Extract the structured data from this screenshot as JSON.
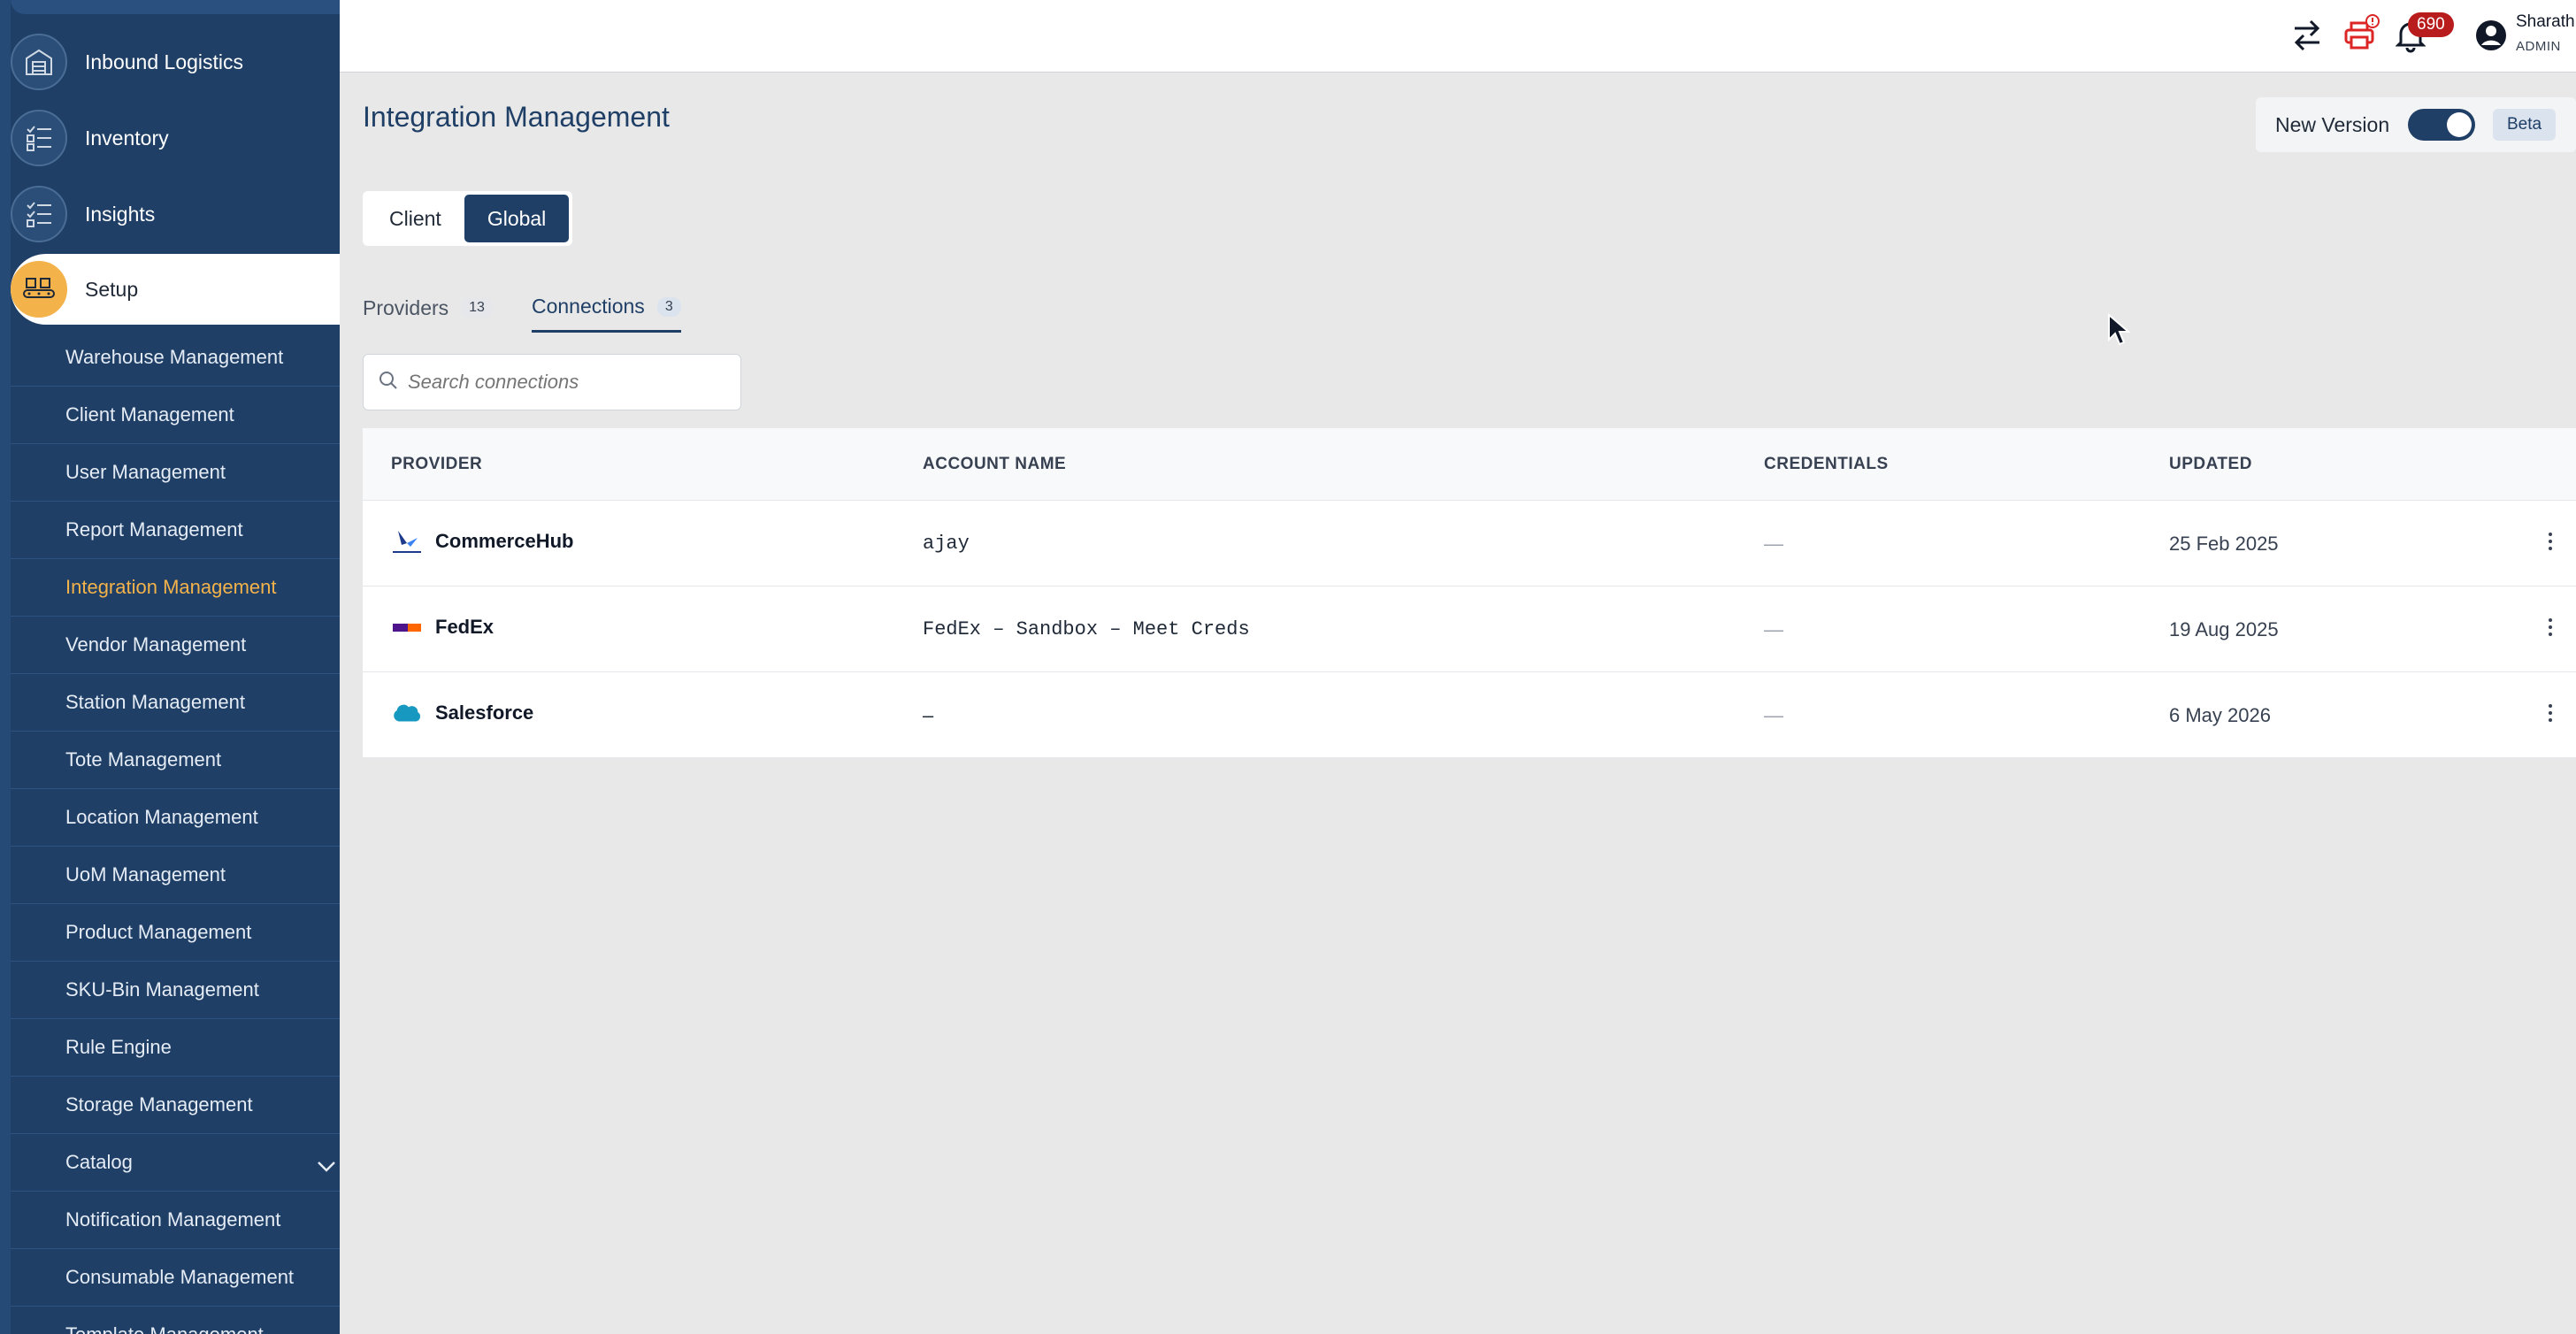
{
  "sidebar": {
    "main_items": [
      {
        "label": "Inbound Logistics",
        "icon": "warehouse-icon"
      },
      {
        "label": "Inventory",
        "icon": "checklist-icon"
      },
      {
        "label": "Insights",
        "icon": "checklist-icon"
      },
      {
        "label": "Setup",
        "icon": "conveyor-icon",
        "active": true
      }
    ],
    "sub_items": [
      {
        "label": "Warehouse Management"
      },
      {
        "label": "Client Management"
      },
      {
        "label": "User Management"
      },
      {
        "label": "Report Management"
      },
      {
        "label": "Integration Management",
        "active": true
      },
      {
        "label": "Vendor Management"
      },
      {
        "label": "Station Management"
      },
      {
        "label": "Tote Management"
      },
      {
        "label": "Location Management"
      },
      {
        "label": "UoM Management"
      },
      {
        "label": "Product Management"
      },
      {
        "label": "SKU-Bin Management"
      },
      {
        "label": "Rule Engine"
      },
      {
        "label": "Storage Management"
      },
      {
        "label": "Catalog",
        "expandable": true
      },
      {
        "label": "Notification Management"
      },
      {
        "label": "Consumable Management"
      },
      {
        "label": "Template Management"
      }
    ]
  },
  "topbar": {
    "notification_count": "690",
    "user_name": "Sharath",
    "user_role": "ADMIN",
    "icons": [
      "transfer-icon",
      "printer-alert-icon",
      "bell-icon",
      "user-account-icon"
    ]
  },
  "page": {
    "title": "Integration Management"
  },
  "version": {
    "label": "New Version",
    "enabled": true,
    "badge": "Beta"
  },
  "scope": {
    "options": [
      "Client",
      "Global"
    ],
    "selected": "Global"
  },
  "tabs": [
    {
      "label": "Providers",
      "count": "13"
    },
    {
      "label": "Connections",
      "count": "3",
      "active": true
    }
  ],
  "search": {
    "placeholder": "Search connections",
    "value": ""
  },
  "table": {
    "columns": [
      "PROVIDER",
      "ACCOUNT NAME",
      "CREDENTIALS",
      "UPDATED"
    ],
    "rows": [
      {
        "provider": "CommerceHub",
        "logo": "commercehub-logo-icon",
        "account": "ajay",
        "credentials": "—",
        "updated": "25 Feb 2025"
      },
      {
        "provider": "FedEx",
        "logo": "fedex-logo-icon",
        "account": "FedEx – Sandbox – Meet Creds",
        "credentials": "—",
        "updated": "19 Aug 2025"
      },
      {
        "provider": "Salesforce",
        "logo": "salesforce-logo-icon",
        "account": "–",
        "credentials": "—",
        "updated": "6 May 2026"
      }
    ]
  },
  "colors": {
    "sidebar": "#1f3f66",
    "accent": "#f3b24a",
    "primary": "#1f3f66",
    "badge": "#b91c1c"
  }
}
